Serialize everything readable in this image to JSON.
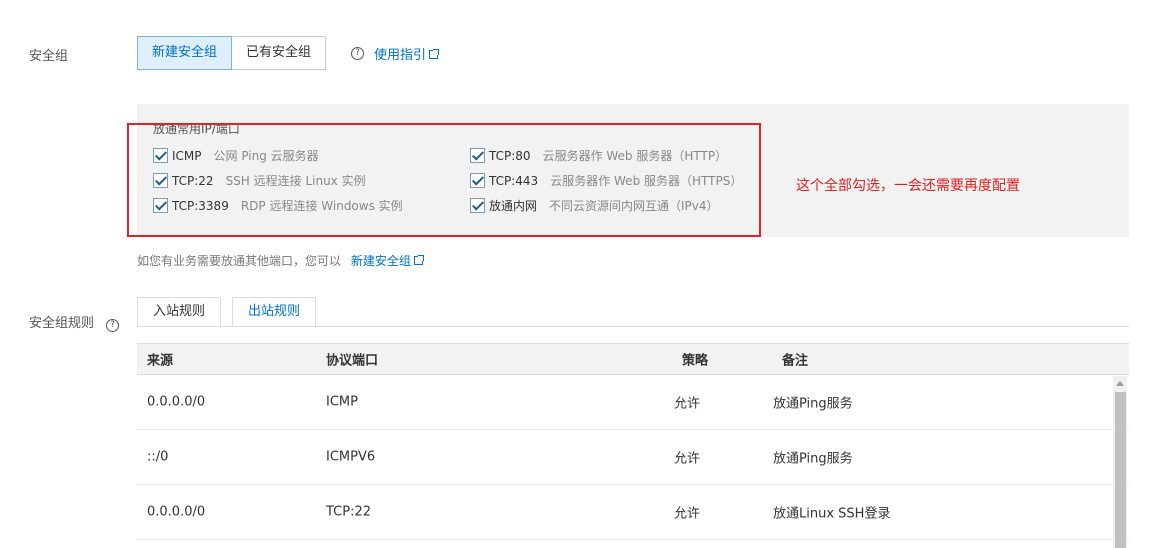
{
  "security_group": {
    "label": "安全组",
    "buttons": {
      "new": "新建安全组",
      "existing": "已有安全组"
    },
    "guide_link": "使用指引"
  },
  "ports_box": {
    "title": "放通常用IP/端口",
    "items": [
      {
        "name": "ICMP",
        "desc": "公网 Ping 云服务器",
        "checked": true
      },
      {
        "name": "TCP:80",
        "desc": "云服务器作 Web 服务器（HTTP）",
        "checked": true
      },
      {
        "name": "TCP:22",
        "desc": "SSH 远程连接 Linux 实例",
        "checked": true
      },
      {
        "name": "TCP:443",
        "desc": "云服务器作 Web 服务器（HTTPS）",
        "checked": true
      },
      {
        "name": "TCP:3389",
        "desc": "RDP 远程连接 Windows 实例",
        "checked": true
      },
      {
        "name": "放通内网",
        "desc": "不同云资源间内网互通（IPv4）",
        "checked": true
      }
    ],
    "annotation": "这个全部勾选，一会还需要再度配置"
  },
  "hint": {
    "text": "如您有业务需要放通其他端口，您可以",
    "link": "新建安全组"
  },
  "rules": {
    "label": "安全组规则",
    "tabs": {
      "inbound": "入站规则",
      "outbound": "出站规则"
    },
    "columns": {
      "source": "来源",
      "protocol": "协议端口",
      "policy": "策略",
      "remark": "备注"
    },
    "rows": [
      {
        "source": "0.0.0.0/0",
        "protocol": "ICMP",
        "policy": "允许",
        "remark": "放通Ping服务"
      },
      {
        "source": "::/0",
        "protocol": "ICMPV6",
        "policy": "允许",
        "remark": "放通Ping服务"
      },
      {
        "source": "0.0.0.0/0",
        "protocol": "TCP:22",
        "policy": "允许",
        "remark": "放通Linux SSH登录"
      }
    ]
  },
  "colors": {
    "accent": "#0070cc",
    "annotation_red": "#d9262c",
    "box_bg": "#f2f2f2"
  }
}
